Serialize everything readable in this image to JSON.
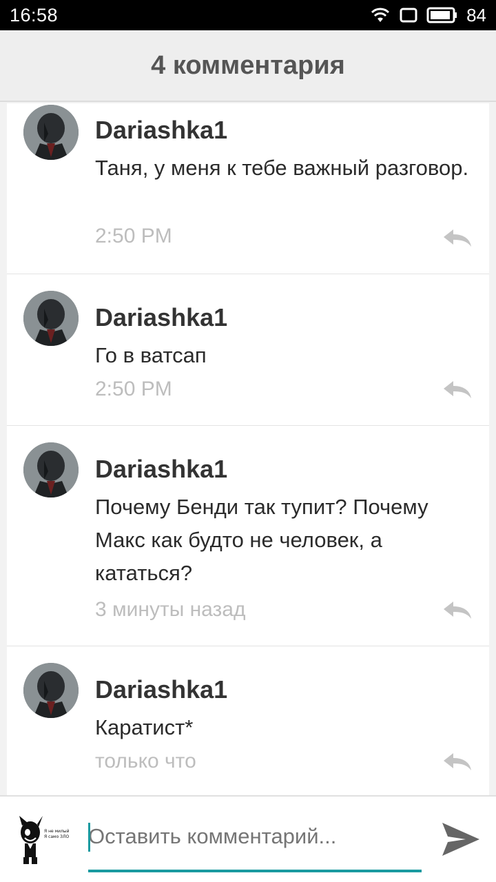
{
  "status_bar": {
    "time": "16:58",
    "battery": "84"
  },
  "header": {
    "title": "4 комментария"
  },
  "comments": [
    {
      "author": "Dariashka1",
      "text": "Таня, у меня к тебе важный разговор.",
      "time": "2:50 PM"
    },
    {
      "author": "Dariashka1",
      "text": "Го в ватсап",
      "time": "2:50 PM"
    },
    {
      "author": "Dariashka1",
      "text": "Почему Бенди так тупит? Почему Макс как будто не человек, а кататься?",
      "time": "3 минуты назад"
    },
    {
      "author": "Dariashka1",
      "text": "Каратист*",
      "time": "только что"
    }
  ],
  "composer": {
    "placeholder": "Оставить комментарий...",
    "avatar_caption_line1": "Я не милый",
    "avatar_caption_line2": "Я само ЗЛО"
  },
  "icons": {
    "wifi": "wifi-icon",
    "screen": "screen-icon",
    "battery": "battery-icon",
    "reply": "reply-icon",
    "send": "send-icon"
  },
  "colors": {
    "accent": "#1a9aa0",
    "time": "#bdbdbd",
    "header_bg": "#eeeeee"
  }
}
